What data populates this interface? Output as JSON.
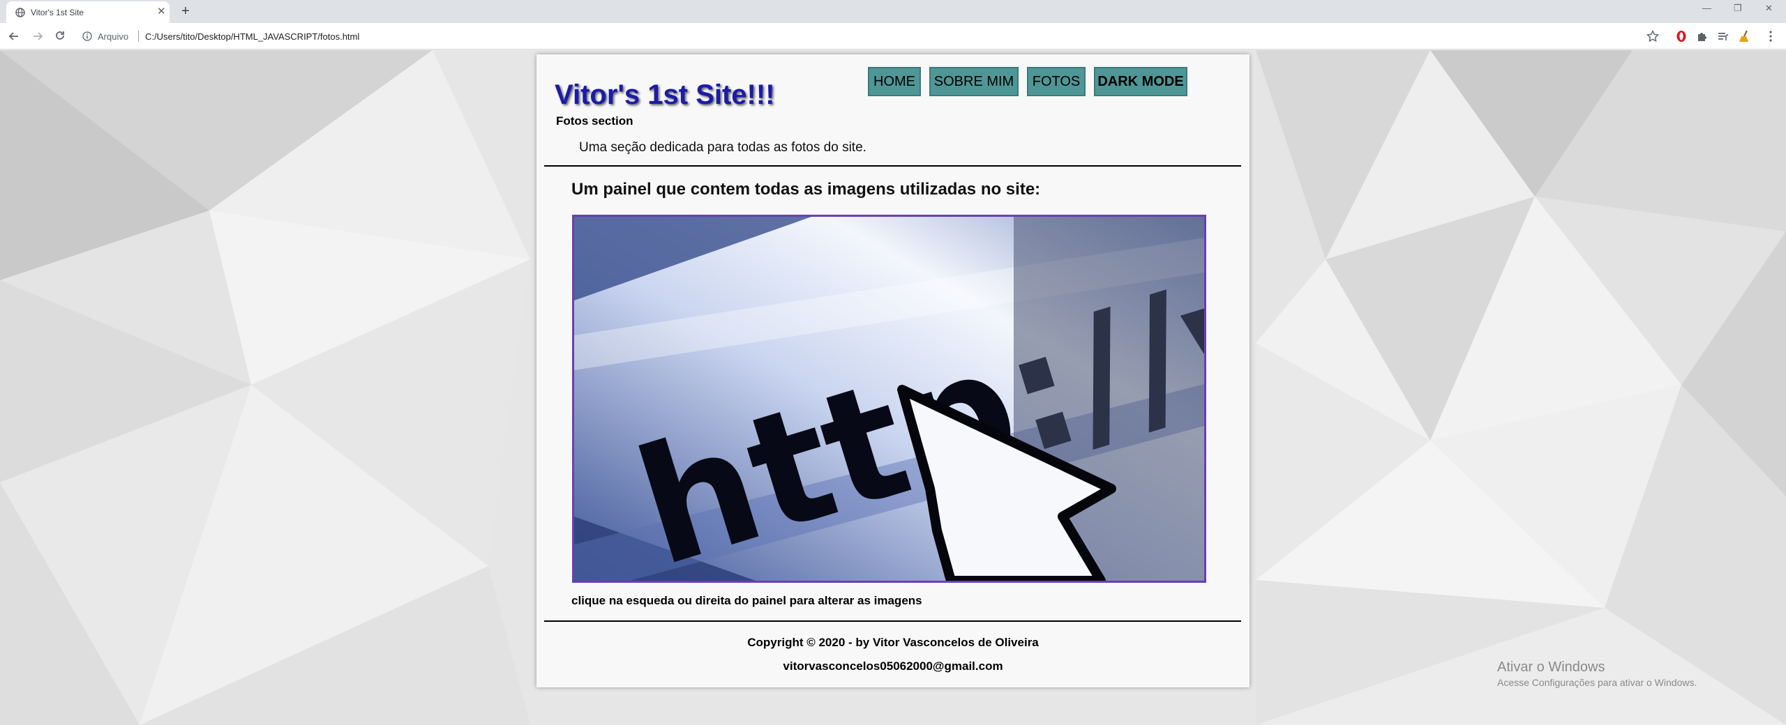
{
  "browser": {
    "tab_title": "Vitor's 1st Site",
    "omnibox_label": "Arquivo",
    "url": "C:/Users/tito/Desktop/HTML_JAVASCRIPT/fotos.html"
  },
  "site": {
    "title": "Vitor's 1st Site!!!",
    "subtitle": "Fotos section",
    "nav": {
      "home": "HOME",
      "about": "SOBRE MIM",
      "photos": "FOTOS",
      "dark_mode": "DARK MODE"
    },
    "intro": "Uma seção dedicada para todas as fotos do site.",
    "panel_heading": "Um painel que contem todas as imagens utilizadas no site:",
    "panel_image_text": "http://ww",
    "panel_hint": "clique na esqueda ou direita do painel para alterar as imagens",
    "footer": {
      "copyright": "Copyright © 2020 - by Vitor Vasconcelos de Oliveira",
      "email": "vitorvasconcelos05062000@gmail.com"
    }
  },
  "windows_watermark": {
    "title": "Ativar o Windows",
    "subtitle": "Acesse Configurações para ativar o Windows."
  },
  "colors": {
    "title": "#1b1ba8",
    "nav_button": "#4f9797",
    "panel_border": "#6a3fb5"
  }
}
